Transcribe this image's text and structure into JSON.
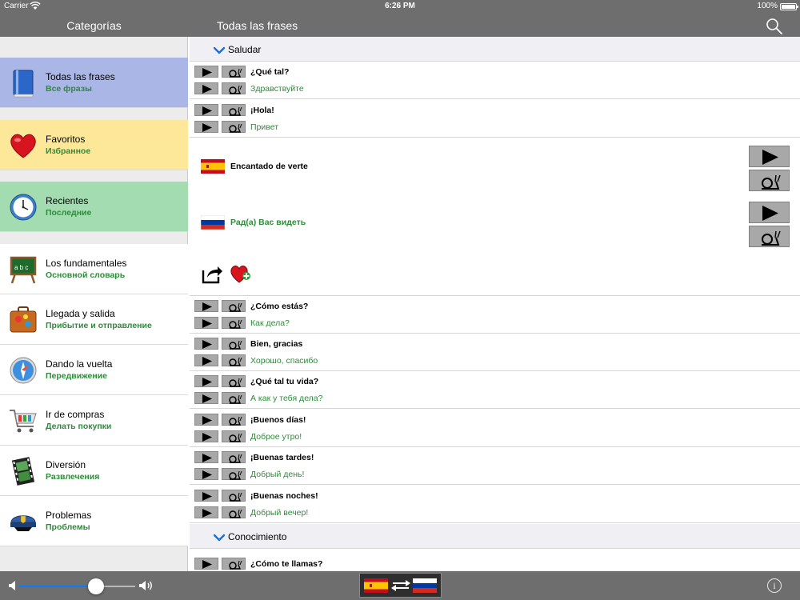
{
  "status_bar": {
    "carrier": "Carrier",
    "wifi_icon": "wifi-icon",
    "time": "6:26 PM",
    "battery": "100%"
  },
  "nav": {
    "left_title": "Categorías",
    "right_title": "Todas las frases",
    "search_icon": "search-icon"
  },
  "colors": {
    "bar_gray": "#6e6e6e",
    "cat_all": "#a9b6e6",
    "cat_favorites": "#fde89a",
    "cat_recent": "#a3dcb0",
    "translation_green": "#2e8b3a",
    "slider_blue": "#0a7aff"
  },
  "sidebar": {
    "items": [
      {
        "es": "Todas las frases",
        "ru": "Все фразы",
        "icon": "book-icon"
      },
      {
        "es": "Favoritos",
        "ru": "Избранное",
        "icon": "heart-icon"
      },
      {
        "es": "Recientes",
        "ru": "Последние",
        "icon": "clock-icon"
      },
      {
        "es": "Los fundamentales",
        "ru": "Основной словарь",
        "icon": "chalkboard-icon"
      },
      {
        "es": "Llegada y salida",
        "ru": "Прибытие и отправление",
        "icon": "suitcase-icon"
      },
      {
        "es": "Dando la vuelta",
        "ru": "Передвижение",
        "icon": "compass-icon"
      },
      {
        "es": "Ir de compras",
        "ru": "Делать покупки",
        "icon": "shopping-cart-icon"
      },
      {
        "es": "Diversión",
        "ru": "Развлечения",
        "icon": "film-icon"
      },
      {
        "es": "Problemas",
        "ru": "Проблемы",
        "icon": "police-cap-icon"
      }
    ]
  },
  "sections": [
    {
      "title": "Saludar"
    },
    {
      "title": "Conocimiento"
    }
  ],
  "phrases": [
    {
      "es": "¿Qué tal?",
      "ru": "Здравствуйте"
    },
    {
      "es": "¡Hola!",
      "ru": "Привет"
    },
    {
      "es": "¿Cómo estás?",
      "ru": "Как дела?"
    },
    {
      "es": "Bien, gracias",
      "ru": "Хорошо, спасибо"
    },
    {
      "es": "¿Qué tal tu vida?",
      "ru": "А как у тебя дела?"
    },
    {
      "es": "¡Buenos días!",
      "ru": "Доброе утро!"
    },
    {
      "es": "¡Buenas tardes!",
      "ru": "Добрый день!"
    },
    {
      "es": "¡Buenas noches!",
      "ru": "Добрый вечер!"
    },
    {
      "es": "¿Cómo te llamas?",
      "ru": ""
    }
  ],
  "expanded_phrase": {
    "es": "Encantado de verte",
    "ru": "Рад(а) Вас видеть",
    "es_flag": "spain-flag-icon",
    "ru_flag": "russia-flag-icon",
    "share_icon": "share-icon",
    "favorite_icon": "add-favorite-heart-icon"
  },
  "toolbar": {
    "volume_level": 0.66,
    "volume_low_icon": "volume-low-icon",
    "volume_high_icon": "volume-high-icon",
    "language_switch_icon": "language-swap-icon",
    "info_label": "i"
  }
}
